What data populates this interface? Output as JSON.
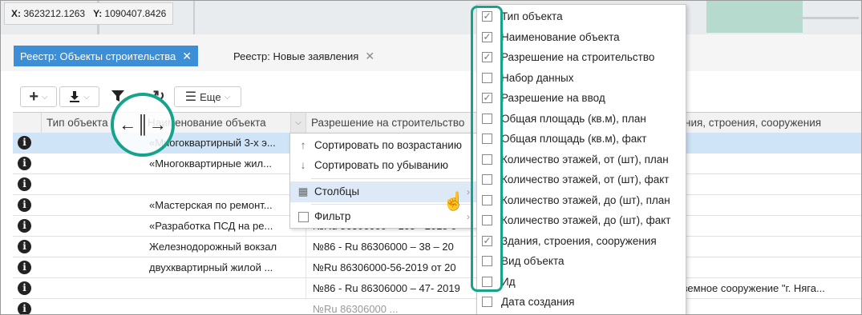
{
  "map": {
    "x_label": "X:",
    "x_value": "3623212.1263",
    "y_label": "Y:",
    "y_value": "1090407.8426"
  },
  "tabs": [
    {
      "label": "Реестр: Объекты строительства",
      "active": true
    },
    {
      "label": "Реестр: Новые заявления",
      "active": false
    }
  ],
  "toolbar": {
    "add_icon": "plus-icon",
    "download_icon": "download-icon",
    "filter_icon": "filter-icon",
    "refresh_icon": "refresh-icon",
    "more_label": "Еще"
  },
  "grid": {
    "columns": [
      "Тип объекта",
      "Наименование объекта",
      "Разрешение на строительство",
      "Здания, строения, сооружения"
    ],
    "visible_column_3_suffix": "ния, строения, сооружения",
    "rows": [
      {
        "name": "«Многоквартирный 3-х э...",
        "permit": "",
        "extra": ""
      },
      {
        "name": "«Многоквартирные жил...",
        "permit": "",
        "extra": ""
      },
      {
        "name": "",
        "permit": "",
        "extra": ""
      },
      {
        "name": "«Мастерская по ремонт...",
        "permit": "",
        "extra": ""
      },
      {
        "name": "«Разработка ПСД на ре...",
        "permit": "№Ru 86306000 – 105 - 2018 о",
        "extra": ""
      },
      {
        "name": "Железнодорожный вокзал",
        "permit": "№86 - Ru 86306000 – 38 – 20",
        "extra": ""
      },
      {
        "name": "двухквартирный жилой ...",
        "permit": "№Ru 86306000-56-2019 от 20",
        "extra": ""
      },
      {
        "name": "",
        "permit": "№86 - Ru 86306000 – 47- 2019",
        "extra": "дземное сооружение \"г. Няга..."
      },
      {
        "name": "",
        "permit": "№Ru 86306000 ...",
        "extra": ""
      }
    ]
  },
  "context_menu": {
    "sort_asc": "Сортировать по возрастанию",
    "sort_desc": "Сортировать по убыванию",
    "columns": "Столбцы",
    "filter": "Фильтр"
  },
  "columns_menu": [
    {
      "label": "Тип объекта",
      "checked": true
    },
    {
      "label": "Наименование объекта",
      "checked": true
    },
    {
      "label": "Разрешение на строительство",
      "checked": true
    },
    {
      "label": "Набор данных",
      "checked": false
    },
    {
      "label": "Разрешение на ввод",
      "checked": true
    },
    {
      "label": "Общая площадь (кв.м), план",
      "checked": false
    },
    {
      "label": "Общая площадь (кв.м), факт",
      "checked": false
    },
    {
      "label": "Количество этажей, от (шт), план",
      "checked": false
    },
    {
      "label": "Количество этажей, от (шт), факт",
      "checked": false
    },
    {
      "label": "Количество этажей, до (шт), план",
      "checked": false
    },
    {
      "label": "Количество этажей, до (шт), факт",
      "checked": false
    },
    {
      "label": "Здания, строения, сооружения",
      "checked": true
    },
    {
      "label": "Вид объекта",
      "checked": false
    },
    {
      "label": "Ид",
      "checked": false
    },
    {
      "label": "Дата создания",
      "checked": false
    }
  ],
  "colors": {
    "accent": "#3c8fd6",
    "highlight": "#16a38b",
    "selected_row": "#cfe4f7"
  }
}
